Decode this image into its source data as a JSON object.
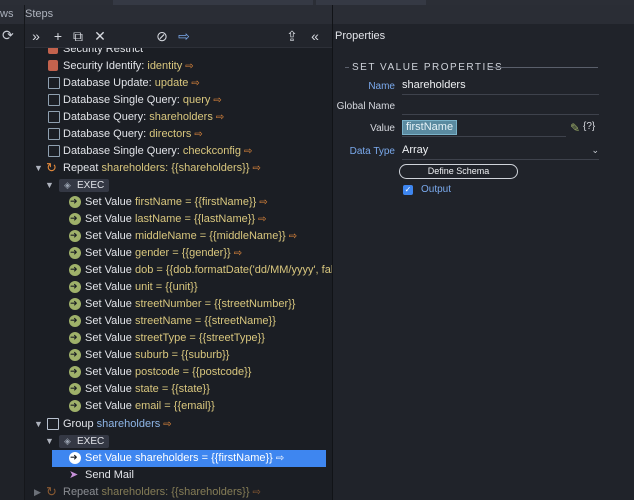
{
  "left_column": {
    "header": "ws",
    "refresh_icon": "refresh-icon"
  },
  "steps": {
    "title": "Steps",
    "toolbar": [
      "expand-icon",
      "add-icon",
      "copy-icon",
      "delete-icon",
      "disable-icon",
      "move-icon",
      "export-icon",
      "collapse-icon"
    ],
    "rows": [
      {
        "text": "Security Restrict",
        "hl": ""
      },
      {
        "text": "Security Identify: ",
        "hl": "identity"
      },
      {
        "text": "Database Update: ",
        "hl": "update"
      },
      {
        "text": "Database Single Query: ",
        "hl": "query"
      },
      {
        "text": "Database Query: ",
        "hl": "shareholders"
      },
      {
        "text": "Database Query: ",
        "hl": "directors"
      },
      {
        "text": "Database Single Query: ",
        "hl": "checkconfig"
      },
      {
        "text": "Repeat ",
        "hl": "shareholders: {{shareholders}}"
      },
      {
        "text": "EXEC",
        "hl": ""
      },
      {
        "text": "Set Value ",
        "hl": "firstName = {{firstName}}"
      },
      {
        "text": "Set Value ",
        "hl": "lastName = {{lastName}}"
      },
      {
        "text": "Set Value ",
        "hl": "middleName = {{middleName}}"
      },
      {
        "text": "Set Value ",
        "hl": "gender = {{gender}}"
      },
      {
        "text": "Set Value ",
        "hl": "dob = {{dob.formatDate('dd/MM/yyyy', false)}}"
      },
      {
        "text": "Set Value ",
        "hl": "unit = {{unit}}"
      },
      {
        "text": "Set Value ",
        "hl": "streetNumber = {{streetNumber}}"
      },
      {
        "text": "Set Value ",
        "hl": "streetName = {{streetName}}"
      },
      {
        "text": "Set Value ",
        "hl": "streetType = {{streetType}}"
      },
      {
        "text": "Set Value ",
        "hl": "suburb = {{suburb}}"
      },
      {
        "text": "Set Value ",
        "hl": "postcode = {{postcode}}"
      },
      {
        "text": "Set Value ",
        "hl": "state = {{state}}"
      },
      {
        "text": "Set Value ",
        "hl": "email = {{email}}"
      },
      {
        "text": "Group ",
        "hl": "shareholders"
      },
      {
        "text": "EXEC",
        "hl": ""
      },
      {
        "text": "Set Value ",
        "hl": "shareholders = {{firstName}}"
      },
      {
        "text": "Send Mail",
        "hl": ""
      },
      {
        "text": "Repeat ",
        "hl": "shareholders: {{shareholders}}"
      }
    ]
  },
  "properties": {
    "title": "Properties",
    "section": "SET VALUE PROPERTIES",
    "name_label": "Name",
    "name_value": "shareholders",
    "global_label": "Global Name",
    "global_value": "",
    "value_label": "Value",
    "value_chip": "firstName",
    "datatype_label": "Data Type",
    "datatype_value": "Array",
    "schema_button": "Define Schema",
    "output_label": "Output",
    "brace_text": "{?}"
  }
}
